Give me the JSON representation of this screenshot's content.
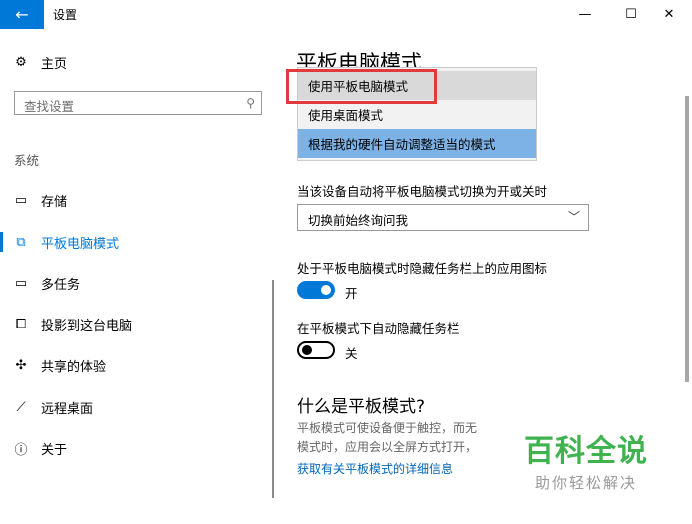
{
  "titlebar": {
    "title": "设置",
    "back_glyph": "←",
    "minimize_glyph": "—",
    "maximize_glyph": "☐",
    "close_glyph": "✕"
  },
  "sidebar": {
    "home": {
      "label": "主页",
      "icon": "gear-icon"
    },
    "search": {
      "placeholder": "查找设置",
      "icon": "search-icon"
    },
    "section": "系统",
    "items": [
      {
        "label": "存储",
        "icon": "storage-icon",
        "active": false
      },
      {
        "label": "平板电脑模式",
        "icon": "tablet-mode-icon",
        "active": true
      },
      {
        "label": "多任务",
        "icon": "multitask-icon",
        "active": false
      },
      {
        "label": "投影到这台电脑",
        "icon": "project-icon",
        "active": false
      },
      {
        "label": "共享的体验",
        "icon": "shared-experience-icon",
        "active": false
      },
      {
        "label": "远程桌面",
        "icon": "remote-desktop-icon",
        "active": false
      },
      {
        "label": "关于",
        "icon": "info-icon",
        "active": false
      }
    ]
  },
  "main": {
    "page_title": "平板电脑模式",
    "signin_menu": {
      "options": [
        "使用平板电脑模式",
        "使用桌面模式",
        "根据我的硬件自动调整适当的模式"
      ],
      "hovered_index": 0,
      "selected_index": 2
    },
    "switch_prompt": {
      "label": "当该设备自动将平板电脑模式切换为开或关时",
      "value": "切换前始终询问我"
    },
    "hide_app_icons": {
      "label": "处于平板电脑模式时隐藏任务栏上的应用图标",
      "state": "开"
    },
    "auto_hide_taskbar": {
      "label": "在平板模式下自动隐藏任务栏",
      "state": "关"
    },
    "what_is": {
      "heading": "什么是平板模式?",
      "line1": "平板模式可使设备便于触控，而无",
      "line2": "模式时，应用会以全屏方式打开，",
      "link": "获取有关平板模式的详细信息"
    }
  },
  "watermark": {
    "brand": "百科全说",
    "slogan": "助你轻松解决"
  },
  "colors": {
    "accent": "#0078d7",
    "highlight_border": "#e0393e",
    "selected_option": "#7db2e6",
    "watermark_green": "#3fb34f"
  }
}
